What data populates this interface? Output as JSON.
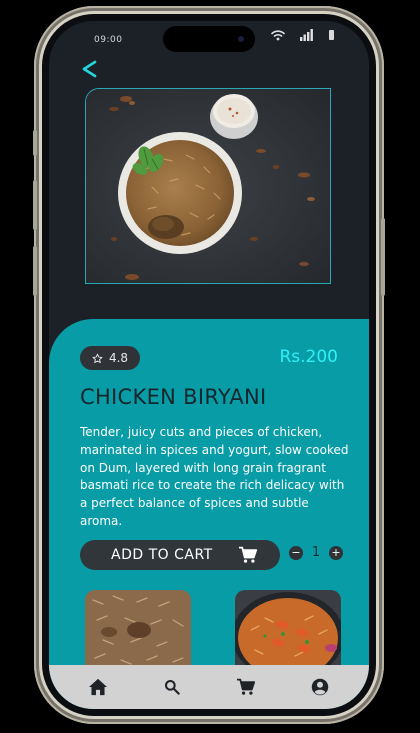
{
  "status_bar": {
    "time": "09:00"
  },
  "product": {
    "rating": "4.8",
    "price": "Rs.200",
    "name": "CHICKEN BIRYANI",
    "description": "Tender, juicy cuts and pieces of chicken, marinated in spices and yogurt, slow cooked on Dum, layered with long grain fragrant basmati rice to create the rich delicacy with a perfect balance of spices and subtle aroma."
  },
  "cart": {
    "add_label": "ADD TO CART",
    "quantity": "1",
    "minus": "−",
    "plus": "+"
  },
  "icons": {
    "back": "chevron-left-icon",
    "star": "star-outline-icon",
    "cart": "cart-icon",
    "home": "home-icon",
    "search": "search-icon",
    "profile": "account-circle-icon"
  },
  "colors": {
    "accent": "#2ff0f5",
    "card": "#089ca7",
    "dark": "#1c2128"
  }
}
